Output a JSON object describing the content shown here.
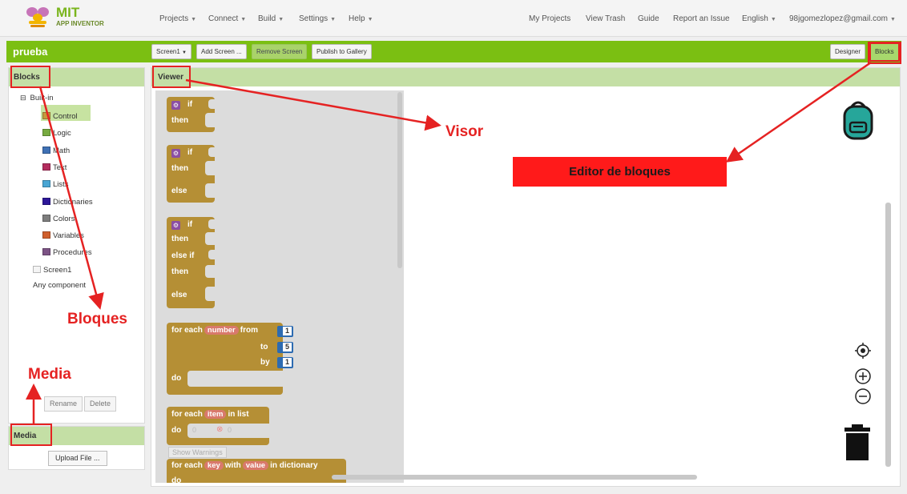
{
  "app": {
    "logo_text": "MIT",
    "logo_sub": "APP INVENTOR"
  },
  "nav": {
    "menus": [
      "Projects",
      "Connect",
      "Build",
      "Settings",
      "Help"
    ],
    "links": [
      "My Projects",
      "View Trash",
      "Guide",
      "Report an Issue"
    ],
    "language": "English",
    "account": "98jgomezlopez@gmail.com"
  },
  "toolbar": {
    "project_name": "prueba",
    "screen_select": "Screen1",
    "add_screen": "Add Screen ...",
    "remove_screen": "Remove Screen",
    "publish": "Publish to Gallery",
    "designer": "Designer",
    "blocks": "Blocks"
  },
  "blocks_panel": {
    "title": "Blocks",
    "builtin_label": "Built-in",
    "items": [
      {
        "label": "Control",
        "color": "#c49a3c"
      },
      {
        "label": "Logic",
        "color": "#77ab41"
      },
      {
        "label": "Math",
        "color": "#3f71b5"
      },
      {
        "label": "Text",
        "color": "#b32d5e"
      },
      {
        "label": "Lists",
        "color": "#49a6d4"
      },
      {
        "label": "Dictionaries",
        "color": "#2d1799"
      },
      {
        "label": "Colors",
        "color": "#7d7d7d"
      },
      {
        "label": "Variables",
        "color": "#d05f2d"
      },
      {
        "label": "Procedures",
        "color": "#7c5385"
      }
    ],
    "screen_label": "Screen1",
    "any_component": "Any component",
    "rename": "Rename",
    "delete": "Delete"
  },
  "media_panel": {
    "title": "Media",
    "upload": "Upload File ..."
  },
  "viewer": {
    "title": "Viewer"
  },
  "blocks": {
    "if": "if",
    "then": "then",
    "else": "else",
    "else_if": "else if",
    "for_each": "for each",
    "from": "from",
    "to": "to",
    "by": "by",
    "do": "do",
    "number_var": "number",
    "from_val": "1",
    "to_val": "5",
    "by_val": "1",
    "item_var": "item",
    "in_list": "in list",
    "key_var": "key",
    "with": "with",
    "value_var": "value",
    "in_dictionary": "in dictionary",
    "warnings_count": "0",
    "errors_count": "0",
    "show_warnings": "Show Warnings"
  },
  "annotations": {
    "visor": "Visor",
    "editor": "Editor de bloques",
    "bloques": "Bloques",
    "media": "Media",
    "color": "#e52222"
  },
  "workspace_icons": [
    "backpack-icon",
    "locate-icon",
    "zoom-in-icon",
    "zoom-out-icon",
    "trash-icon"
  ]
}
